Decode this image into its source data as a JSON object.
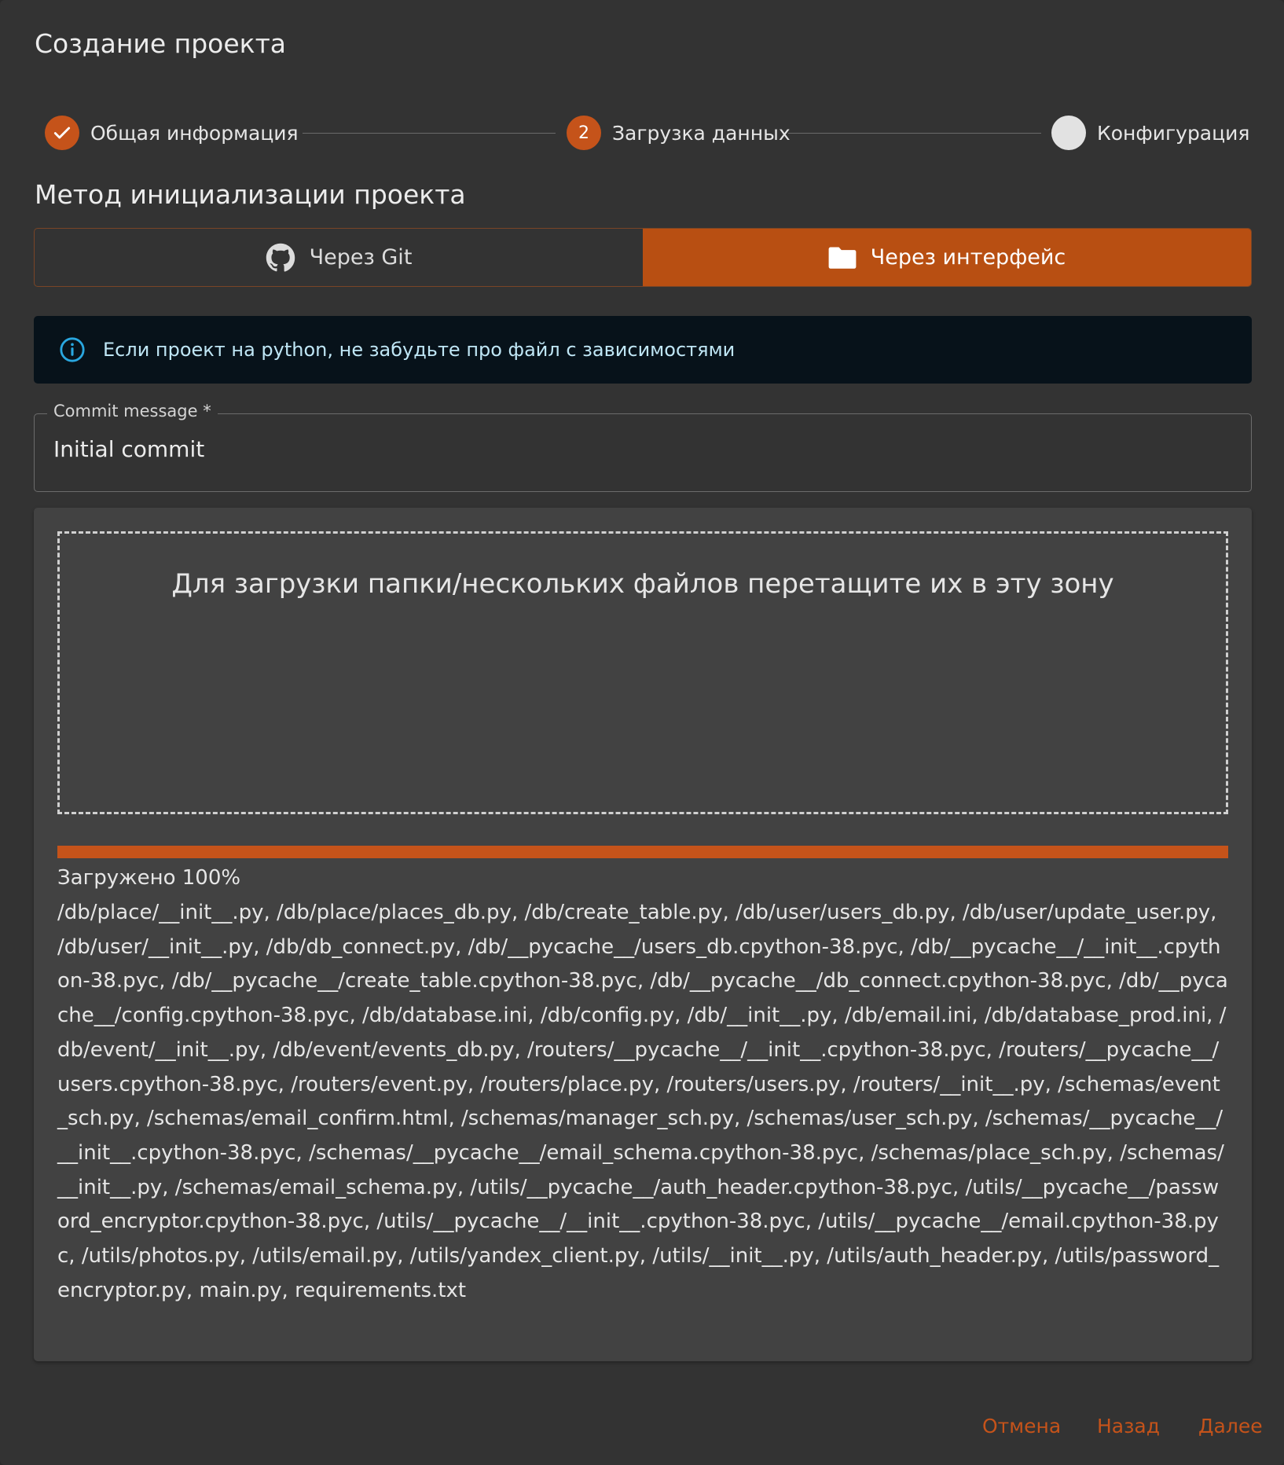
{
  "dialog": {
    "title": "Создание проекта"
  },
  "stepper": {
    "steps": [
      {
        "label": "Общая информация",
        "state": "done"
      },
      {
        "label": "Загрузка данных",
        "state": "active",
        "number": "2"
      },
      {
        "label": "Конфигурация",
        "state": "pending"
      }
    ]
  },
  "init_method": {
    "title": "Метод инициализации проекта",
    "options": [
      {
        "label": "Через Git",
        "icon": "github-icon",
        "selected": false
      },
      {
        "label": "Через интерфейс",
        "icon": "folder-icon",
        "selected": true
      }
    ]
  },
  "alert": {
    "icon": "info-icon",
    "text": "Если проект на python, не забудьте про файл с зависимостями"
  },
  "commit_field": {
    "label": "Commit message *",
    "value": "Initial commit"
  },
  "upload": {
    "dropzone_text": "Для загрузки папки/нескольких файлов перетащите их в эту зону",
    "progress_label": "Загружено 100%",
    "progress_fraction": 1.0,
    "files": "/db/place/__init__.py, /db/place/places_db.py, /db/create_table.py, /db/user/users_db.py, /db/user/update_user.py, /db/user/__init__.py, /db/db_connect.py, /db/__pycache__/users_db.cpython-38.pyc, /db/__pycache__/__init__.cpython-38.pyc, /db/__pycache__/create_table.cpython-38.pyc, /db/__pycache__/db_connect.cpython-38.pyc, /db/__pycache__/config.cpython-38.pyc, /db/database.ini, /db/config.py, /db/__init__.py, /db/email.ini, /db/database_prod.ini, /db/event/__init__.py, /db/event/events_db.py, /routers/__pycache__/__init__.cpython-38.pyc, /routers/__pycache__/users.cpython-38.pyc, /routers/event.py, /routers/place.py, /routers/users.py, /routers/__init__.py, /schemas/event_sch.py, /schemas/email_confirm.html, /schemas/manager_sch.py, /schemas/user_sch.py, /schemas/__pycache__/__init__.cpython-38.pyc, /schemas/__pycache__/email_schema.cpython-38.pyc, /schemas/place_sch.py, /schemas/__init__.py, /schemas/email_schema.py, /utils/__pycache__/auth_header.cpython-38.pyc, /utils/__pycache__/password_encryptor.cpython-38.pyc, /utils/__pycache__/__init__.cpython-38.pyc, /utils/__pycache__/email.cpython-38.pyc, /utils/photos.py, /utils/email.py, /utils/yandex_client.py, /utils/__init__.py, /utils/auth_header.py, /utils/password_encryptor.py, main.py, requirements.txt"
  },
  "footer": {
    "cancel_label": "Отмена",
    "back_label": "Назад",
    "next_label": "Далее"
  },
  "colors": {
    "accent": "#c5531a",
    "background": "#333333",
    "panel": "#424242",
    "alert_bg": "#07121a",
    "alert_text": "#bfe6f5"
  }
}
